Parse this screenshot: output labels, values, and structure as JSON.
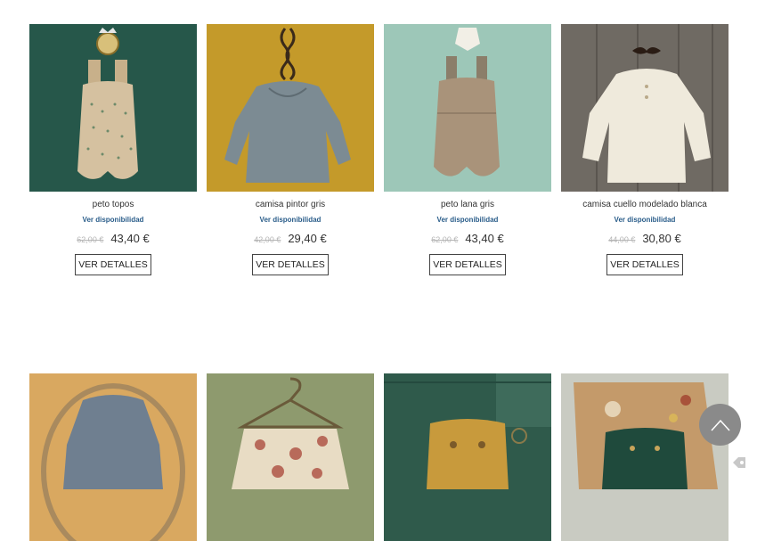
{
  "products": [
    {
      "name": "peto topos",
      "availability": "Ver disponibilidad",
      "old_price": "62,00 €",
      "price": "43,40 €",
      "button": "VER DETALLES",
      "image_bg": "#26574a"
    },
    {
      "name": "camisa pintor gris",
      "availability": "Ver disponibilidad",
      "old_price": "42,00 €",
      "price": "29,40 €",
      "button": "VER DETALLES",
      "image_bg": "#c49a2a"
    },
    {
      "name": "peto lana gris",
      "availability": "Ver disponibilidad",
      "old_price": "62,00 €",
      "price": "43,40 €",
      "button": "VER DETALLES",
      "image_bg": "#9dc7b8"
    },
    {
      "name": "camisa cuello modelado blanca",
      "availability": "Ver disponibilidad",
      "old_price": "44,00 €",
      "price": "30,80 €",
      "button": "VER DETALLES",
      "image_bg": "#6f6a63"
    }
  ],
  "second_row": [
    {
      "image_bg": "#d9a860"
    },
    {
      "image_bg": "#8e9a6e"
    },
    {
      "image_bg": "#2f5a4b"
    },
    {
      "image_bg": "#c9cbc2"
    }
  ],
  "icons": {
    "scroll_top": "chevron-up-icon",
    "corner": "tag-icon"
  }
}
